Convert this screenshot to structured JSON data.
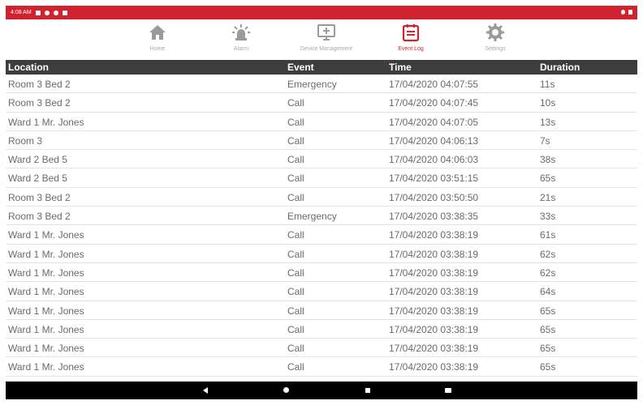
{
  "status_bar": {
    "time": "4:08 AM"
  },
  "nav": {
    "items": [
      {
        "label": "Home",
        "icon": "home-icon"
      },
      {
        "label": "Alarm",
        "icon": "alarm-icon"
      },
      {
        "label": "Device Management",
        "icon": "device-management-icon"
      },
      {
        "label": "Event Log",
        "icon": "event-log-icon",
        "active": true
      },
      {
        "label": "Settings",
        "icon": "gear-icon"
      }
    ]
  },
  "table": {
    "headers": [
      "Location",
      "Event",
      "Time",
      "Duration"
    ],
    "rows": [
      [
        "Room 3 Bed 2",
        "Emergency",
        "17/04/2020 04:07:55",
        "11s"
      ],
      [
        "Room 3 Bed 2",
        "Call",
        "17/04/2020 04:07:45",
        "10s"
      ],
      [
        "Ward 1 Mr. Jones",
        "Call",
        "17/04/2020 04:07:05",
        "13s"
      ],
      [
        "Room 3",
        "Call",
        "17/04/2020 04:06:13",
        "7s"
      ],
      [
        "Ward 2 Bed 5",
        "Call",
        "17/04/2020 04:06:03",
        "38s"
      ],
      [
        "Ward 2 Bed 5",
        "Call",
        "17/04/2020 03:51:15",
        "65s"
      ],
      [
        "Room 3 Bed 2",
        "Call",
        "17/04/2020 03:50:50",
        "21s"
      ],
      [
        "Room 3 Bed 2",
        "Emergency",
        "17/04/2020 03:38:35",
        "33s"
      ],
      [
        "Ward 1 Mr. Jones",
        "Call",
        "17/04/2020 03:38:19",
        "61s"
      ],
      [
        "Ward 1 Mr. Jones",
        "Call",
        "17/04/2020 03:38:19",
        "62s"
      ],
      [
        "Ward 1 Mr. Jones",
        "Call",
        "17/04/2020 03:38:19",
        "62s"
      ],
      [
        "Ward 1 Mr. Jones",
        "Call",
        "17/04/2020 03:38:19",
        "64s"
      ],
      [
        "Ward 1 Mr. Jones",
        "Call",
        "17/04/2020 03:38:19",
        "65s"
      ],
      [
        "Ward 1 Mr. Jones",
        "Call",
        "17/04/2020 03:38:19",
        "65s"
      ],
      [
        "Ward 1 Mr. Jones",
        "Call",
        "17/04/2020 03:38:19",
        "65s"
      ],
      [
        "Ward 1 Mr. Jones",
        "Call",
        "17/04/2020 03:38:19",
        "65s"
      ]
    ]
  },
  "colors": {
    "accent": "#d1232f",
    "header_bg": "#3d3d3d",
    "icon_gray": "#9a9a9a"
  },
  "system_nav": {
    "icons": [
      "back-icon",
      "home-circle-icon",
      "recents-icon",
      "keyboard-icon"
    ]
  }
}
